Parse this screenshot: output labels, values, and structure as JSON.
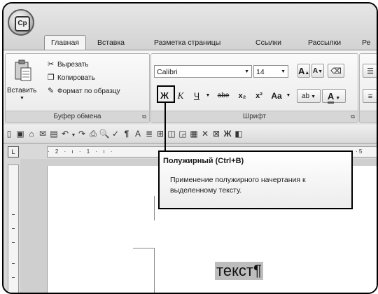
{
  "office_button": {
    "logo": "Cp"
  },
  "tabs": [
    "Главная",
    "Вставка",
    "Разметка страницы",
    "Ссылки",
    "Рассылки",
    "Ре"
  ],
  "clipboard": {
    "paste": "Вставить",
    "cut": "Вырезать",
    "copy": "Копировать",
    "format_painter": "Формат по образцу",
    "label": "Буфер обмена"
  },
  "font": {
    "name": "Calibri",
    "size": "14",
    "label": "Шрифт",
    "bold": "Ж",
    "italic": "К",
    "underline": "Ч",
    "strike": "abe",
    "subscript": "x₂",
    "superscript": "x²",
    "change_case": "Aa",
    "grow": "A",
    "shrink": "A",
    "highlight": "ab",
    "font_color": "A"
  },
  "tooltip": {
    "title": "Полужирный (Ctrl+B)",
    "body": "Применение полужирного начертания к выделенному тексту."
  },
  "ruler": {
    "text": "· 2 · ı · 1 · ı ·",
    "right_mark": "· 5"
  },
  "qat_bold": "Ж",
  "document": {
    "text": "текст¶"
  }
}
